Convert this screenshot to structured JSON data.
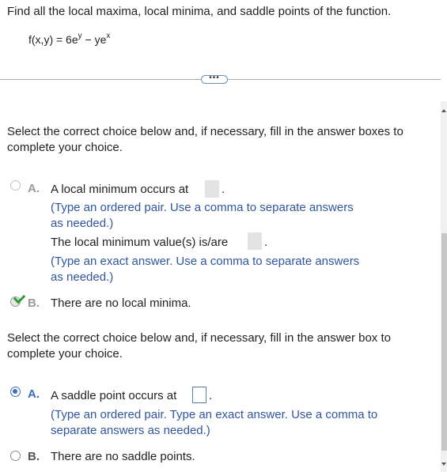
{
  "question": {
    "prompt": "Find all the local maxima, local minima, and saddle points of the function.",
    "formula_lhs": "f(x,y) = 6e",
    "formula_exp1": "y",
    "formula_mid": " − ye",
    "formula_exp2": "x"
  },
  "expand_button": "•••",
  "part1": {
    "instruction": "Select the correct choice below and, if necessary, fill in the answer boxes to complete your choice.",
    "optionA": {
      "letter": "A.",
      "line1": "A local minimum occurs at",
      "hint1_line1": "(Type an ordered pair. Use a comma to separate answers",
      "hint1_line2": "as needed.)",
      "line2": "The local minimum value(s) is/are",
      "hint2_line1": "(Type an exact answer. Use a comma to separate answers",
      "hint2_line2": "as needed.)"
    },
    "optionB": {
      "letter": "B.",
      "text": "There are no local minima."
    }
  },
  "part2": {
    "instruction": "Select the correct choice below and, if necessary, fill in the answer box to complete your choice.",
    "optionA": {
      "letter": "A.",
      "text": "A saddle point occurs at",
      "hint_line1": "(Type an ordered pair. Type an exact answer. Use a comma to",
      "hint_line2": "separate answers as needed.)"
    },
    "optionB": {
      "letter": "B.",
      "text": "There are no saddle points."
    }
  },
  "colors": {
    "accent": "#3b6fb6",
    "hint_text": "#3056a0",
    "correct_check": "#2e9a36"
  }
}
